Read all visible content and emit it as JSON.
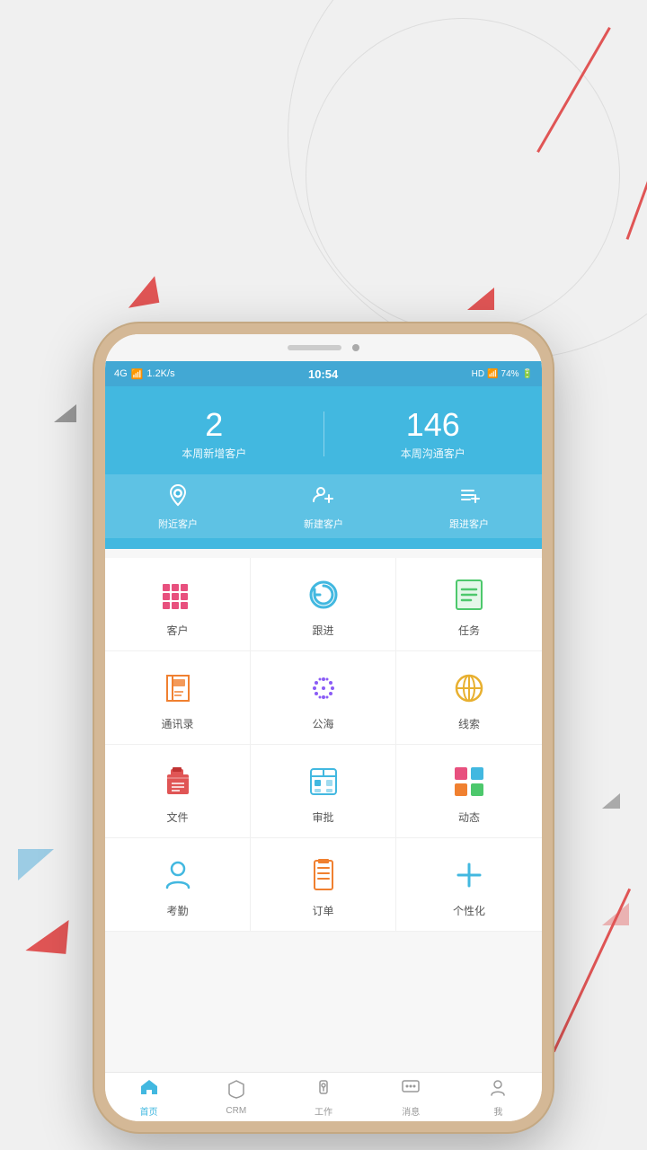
{
  "background": {
    "color": "#f0f0f0"
  },
  "status_bar": {
    "network": "4G",
    "signal": "4G",
    "speed": "1.2K/s",
    "time": "10:54",
    "battery": "74%",
    "wifi": "HD"
  },
  "header": {
    "stat1_number": "2",
    "stat1_label": "本周新增客户",
    "stat2_number": "146",
    "stat2_label": "本周沟通客户",
    "quick_actions": [
      {
        "label": "附近客户",
        "icon": "📍"
      },
      {
        "label": "新建客户",
        "icon": "👥"
      },
      {
        "label": "跟进客户",
        "icon": "📋"
      }
    ]
  },
  "menu_items": [
    {
      "label": "客户",
      "color": "#e8507e",
      "type": "grid"
    },
    {
      "label": "跟进",
      "color": "#42b8e0",
      "type": "refresh"
    },
    {
      "label": "任务",
      "color": "#4dc86c",
      "type": "list"
    },
    {
      "label": "通讯录",
      "color": "#f08030",
      "type": "book"
    },
    {
      "label": "公海",
      "color": "#8b5cf6",
      "type": "dots"
    },
    {
      "label": "线索",
      "color": "#e8b030",
      "type": "globe"
    },
    {
      "label": "文件",
      "color": "#e05555",
      "type": "file"
    },
    {
      "label": "审批",
      "color": "#42b8e0",
      "type": "calendar"
    },
    {
      "label": "动态",
      "color": "#e8507e",
      "type": "grid4"
    },
    {
      "label": "考勤",
      "color": "#42b8e0",
      "type": "person"
    },
    {
      "label": "订单",
      "color": "#f08030",
      "type": "clipboard"
    },
    {
      "label": "个性化",
      "color": "#42b8e0",
      "type": "plus"
    }
  ],
  "bottom_nav": [
    {
      "label": "首页",
      "icon": "🏠",
      "active": true
    },
    {
      "label": "CRM",
      "icon": "🛡",
      "active": false
    },
    {
      "label": "工作",
      "icon": "🔒",
      "active": false
    },
    {
      "label": "消息",
      "icon": "💬",
      "active": false
    },
    {
      "label": "我",
      "icon": "👤",
      "active": false
    }
  ]
}
